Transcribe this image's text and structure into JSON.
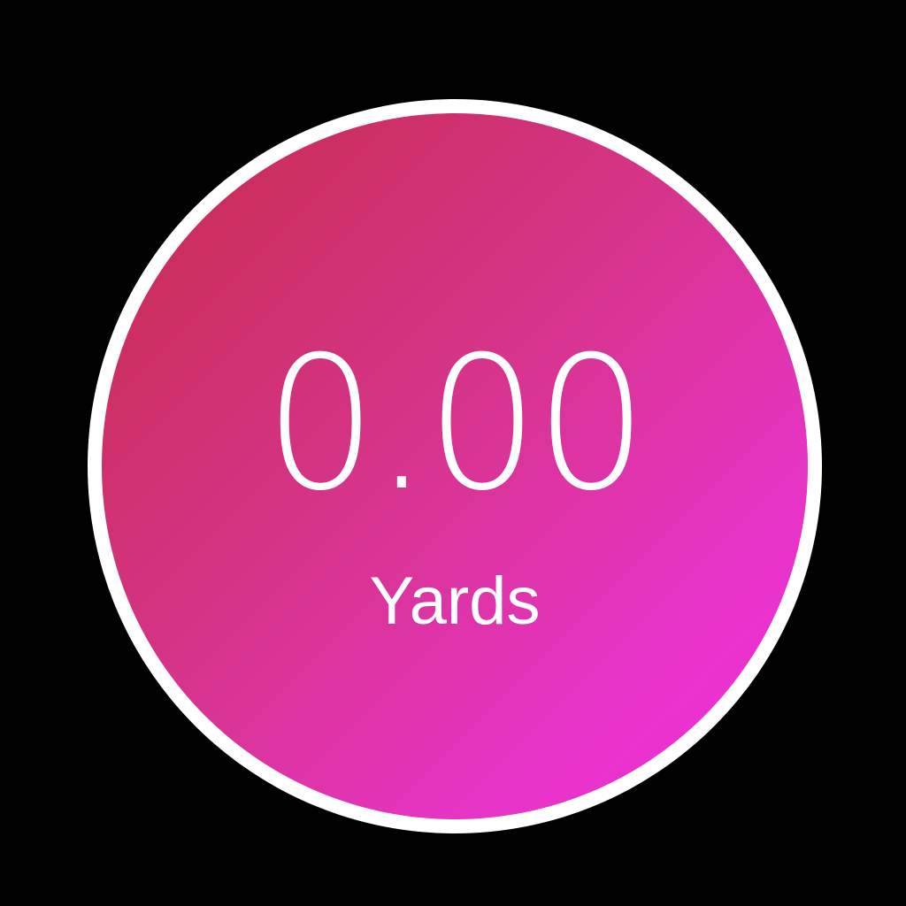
{
  "distance": {
    "value": "0.00",
    "unit": "Yards"
  },
  "colors": {
    "background": "#000000",
    "ring": "#ffffff",
    "gradient_start": "#c62c48",
    "gradient_end": "#f22ce0",
    "text": "#ffffff"
  }
}
